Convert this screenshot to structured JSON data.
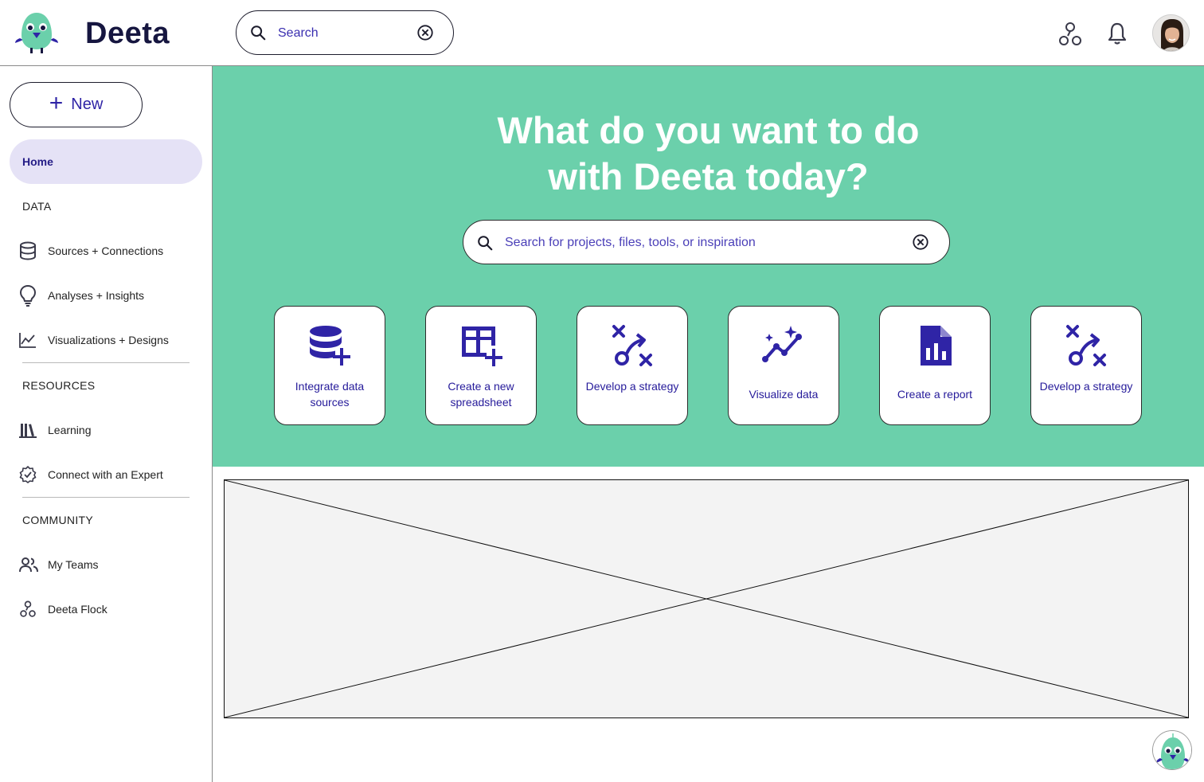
{
  "header": {
    "brand": "Deeta",
    "search_placeholder": "Search",
    "icons": [
      "deeta-logo",
      "search-icon",
      "clear-icon",
      "flock-icon",
      "bell-icon",
      "user-avatar"
    ]
  },
  "sidebar": {
    "new_label": "New",
    "home_label": "Home",
    "sections": {
      "data": "DATA",
      "resources": "RESOURCES",
      "community": "COMMUNITY"
    },
    "data_items": [
      {
        "label": "Sources + Connections",
        "icon": "database-icon"
      },
      {
        "label": "Analyses + Insights",
        "icon": "lightbulb-icon"
      },
      {
        "label": "Visualizations + Designs",
        "icon": "line-chart-icon"
      }
    ],
    "resource_items": [
      {
        "label": "Learning",
        "icon": "books-icon"
      },
      {
        "label": "Connect with an Expert",
        "icon": "verified-badge-icon"
      }
    ],
    "community_items": [
      {
        "label": "My Teams",
        "icon": "people-icon"
      },
      {
        "label": "Deeta Flock",
        "icon": "flock-icon"
      }
    ]
  },
  "hero": {
    "title_line1": "What do you want to do",
    "title_line2": "with Deeta today?",
    "search_placeholder": "Search for projects, files, tools, or inspiration",
    "cards": [
      {
        "label": "Integrate data sources",
        "icon": "add-database-icon"
      },
      {
        "label": "Create a new spreadsheet",
        "icon": "add-table-icon"
      },
      {
        "label": "Develop a strategy",
        "icon": "strategy-icon"
      },
      {
        "label": "Visualize data",
        "icon": "sparkle-trend-icon"
      },
      {
        "label": "Create a report",
        "icon": "report-icon"
      },
      {
        "label": "Develop a strategy",
        "icon": "strategy-icon"
      }
    ]
  },
  "colors": {
    "accent": "#2f24a6",
    "hero_bg": "#6bd0ab",
    "nav_active_bg": "#e5e2f6",
    "brand_text": "#161640"
  }
}
